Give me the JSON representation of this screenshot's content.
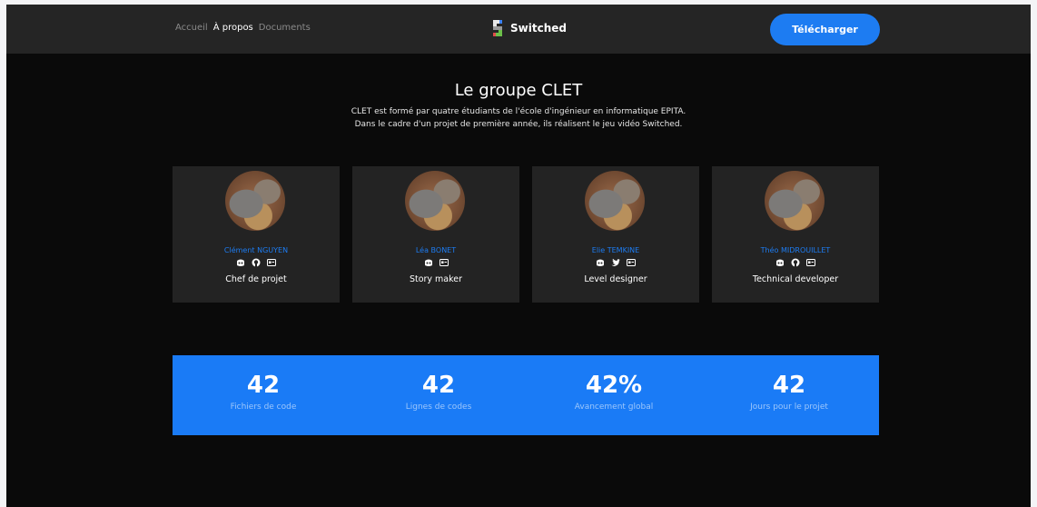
{
  "nav": {
    "links": [
      "Accueil",
      "À propos",
      "Documents"
    ],
    "brand": "Switched",
    "download": "Télécharger"
  },
  "intro": {
    "title": "Le groupe CLET",
    "line1": "CLET est formé par quatre étudiants de l'école d'ingénieur en informatique EPITA.",
    "line2": "Dans le cadre d'un projet de première année, ils réalisent le jeu vidéo Switched."
  },
  "members": [
    {
      "name": "Clément NGUYEN",
      "role": "Chef de projet",
      "socials": [
        "discord-icon",
        "github-icon",
        "id-card-icon"
      ]
    },
    {
      "name": "Léa BONET",
      "role": "Story maker",
      "socials": [
        "discord-icon",
        "id-card-icon"
      ]
    },
    {
      "name": "Elie TEMKINE",
      "role": "Level designer",
      "socials": [
        "discord-icon",
        "twitter-icon",
        "id-card-icon"
      ]
    },
    {
      "name": "Théo MIDROUILLET",
      "role": "Technical developer",
      "socials": [
        "discord-icon",
        "github-icon",
        "id-card-icon"
      ]
    }
  ],
  "stats": [
    {
      "value": "42",
      "label": "Fichiers de code"
    },
    {
      "value": "42",
      "label": "Lignes de codes"
    },
    {
      "value": "42%",
      "label": "Avancement global"
    },
    {
      "value": "42",
      "label": "Jours pour le projet"
    }
  ],
  "colors": {
    "accent": "#1d7cf2",
    "background": "#0a0a0a",
    "navbar": "#252525",
    "card": "#232323"
  }
}
